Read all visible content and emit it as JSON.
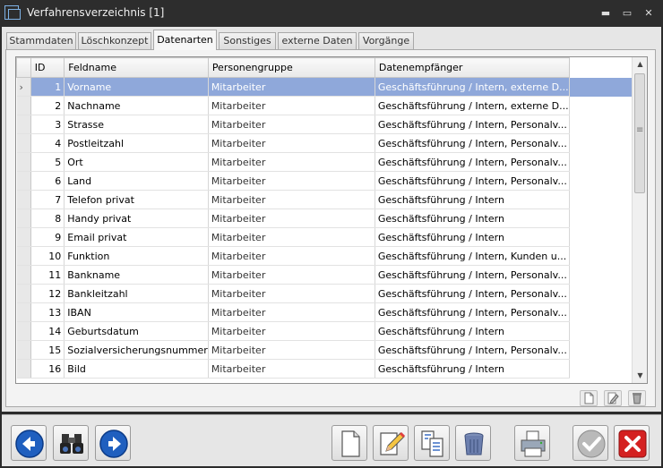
{
  "window": {
    "title": "Verfahrensverzeichnis [1]",
    "buttons": {
      "minimize": "▬",
      "maximize": "▭",
      "close": "✕"
    }
  },
  "tabs": [
    {
      "label": "Stammdaten"
    },
    {
      "label": "Löschkonzept"
    },
    {
      "label": "Datenarten",
      "active": true
    },
    {
      "label": "Sonstiges"
    },
    {
      "label": "externe Daten"
    },
    {
      "label": "Vorgänge"
    }
  ],
  "grid": {
    "columns": [
      "ID",
      "Feldname",
      "Personengruppe",
      "Datenempfänger"
    ],
    "rows": [
      {
        "id": "1",
        "feldname": "Vorname",
        "personengruppe": "Mitarbeiter",
        "empfaenger": "Geschäftsführung / Intern, externe D...",
        "selected": true
      },
      {
        "id": "2",
        "feldname": "Nachname",
        "personengruppe": "Mitarbeiter",
        "empfaenger": "Geschäftsführung / Intern, externe D..."
      },
      {
        "id": "3",
        "feldname": "Strasse",
        "personengruppe": "Mitarbeiter",
        "empfaenger": "Geschäftsführung / Intern, Personalv..."
      },
      {
        "id": "4",
        "feldname": "Postleitzahl",
        "personengruppe": "Mitarbeiter",
        "empfaenger": "Geschäftsführung / Intern, Personalv..."
      },
      {
        "id": "5",
        "feldname": "Ort",
        "personengruppe": "Mitarbeiter",
        "empfaenger": "Geschäftsführung / Intern, Personalv..."
      },
      {
        "id": "6",
        "feldname": "Land",
        "personengruppe": "Mitarbeiter",
        "empfaenger": "Geschäftsführung / Intern, Personalv..."
      },
      {
        "id": "7",
        "feldname": "Telefon privat",
        "personengruppe": "Mitarbeiter",
        "empfaenger": "Geschäftsführung / Intern"
      },
      {
        "id": "8",
        "feldname": "Handy privat",
        "personengruppe": "Mitarbeiter",
        "empfaenger": "Geschäftsführung / Intern"
      },
      {
        "id": "9",
        "feldname": "Email privat",
        "personengruppe": "Mitarbeiter",
        "empfaenger": "Geschäftsführung / Intern"
      },
      {
        "id": "10",
        "feldname": "Funktion",
        "personengruppe": "Mitarbeiter",
        "empfaenger": "Geschäftsführung / Intern, Kunden u..."
      },
      {
        "id": "11",
        "feldname": "Bankname",
        "personengruppe": "Mitarbeiter",
        "empfaenger": "Geschäftsführung / Intern, Personalv..."
      },
      {
        "id": "12",
        "feldname": "Bankleitzahl",
        "personengruppe": "Mitarbeiter",
        "empfaenger": "Geschäftsführung / Intern, Personalv..."
      },
      {
        "id": "13",
        "feldname": "IBAN",
        "personengruppe": "Mitarbeiter",
        "empfaenger": "Geschäftsführung / Intern, Personalv..."
      },
      {
        "id": "14",
        "feldname": "Geburtsdatum",
        "personengruppe": "Mitarbeiter",
        "empfaenger": "Geschäftsführung / Intern"
      },
      {
        "id": "15",
        "feldname": "Sozialversicherungsnummer",
        "personengruppe": "Mitarbeiter",
        "empfaenger": "Geschäftsführung / Intern, Personalv..."
      },
      {
        "id": "16",
        "feldname": "Bild",
        "personengruppe": "Mitarbeiter",
        "empfaenger": "Geschäftsführung / Intern"
      }
    ],
    "row_indicator": "›"
  },
  "icons": {
    "grid_tools": [
      "new-document-icon",
      "edit-icon",
      "delete-icon"
    ],
    "toolbar": [
      "back-arrow-icon",
      "binoculars-icon",
      "forward-arrow-icon",
      "new-document-icon",
      "edit-pencil-icon",
      "copy-document-icon",
      "trash-icon",
      "printer-icon",
      "ok-check-icon",
      "cancel-x-icon"
    ]
  },
  "colors": {
    "selection": "#8fa8da",
    "nav_blue": "#1f5fbf",
    "cancel_red": "#d42020",
    "title_bar": "#2d2d2d"
  }
}
